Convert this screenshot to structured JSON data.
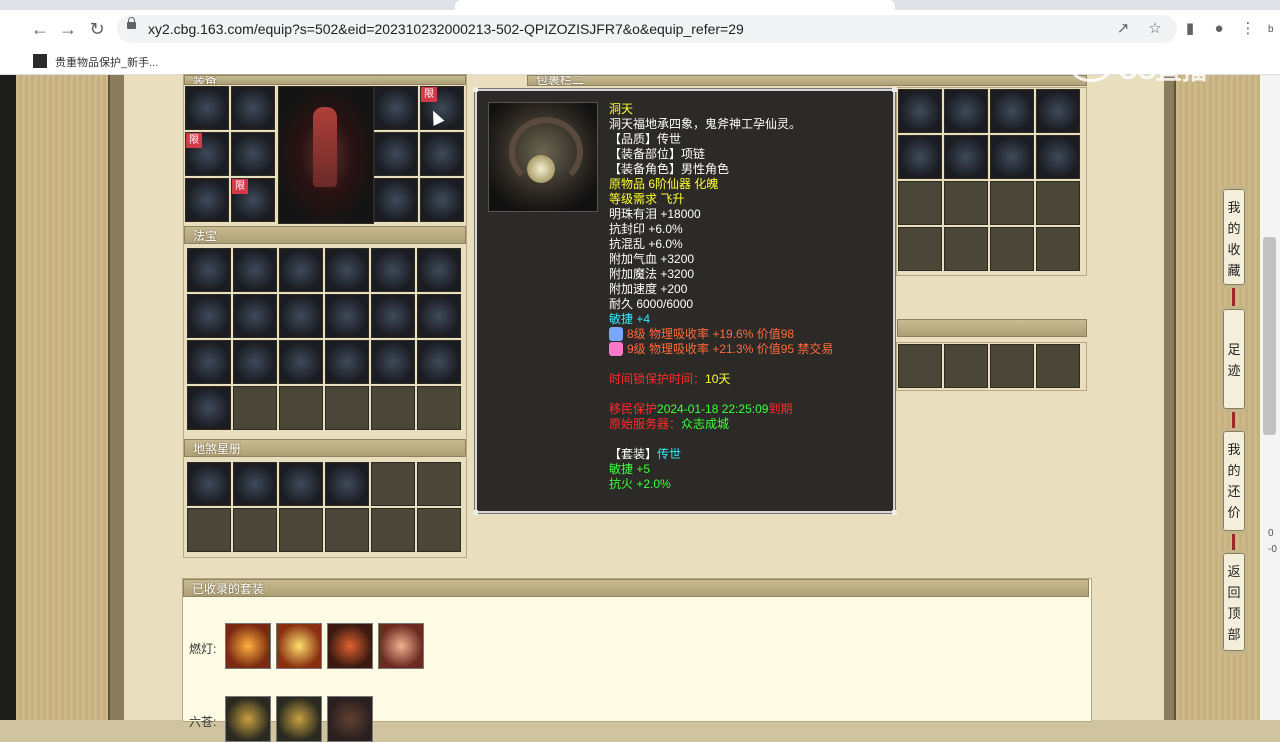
{
  "browser": {
    "url": "xy2.cbg.163.com/equip?s=502&eid=202310232000213-502-QPIZOZISJFR7&o&equip_refer=29",
    "bookmark_label": "贵重物品保护_新手..."
  },
  "watermark": "CC直播",
  "panels": {
    "equip_head": "装备",
    "fabao_head": "法宝",
    "dishu_head": "地煞星册",
    "right_head": "包裹栏二",
    "sets_head": "已收录的套装"
  },
  "equip": {
    "xian_badge": "限"
  },
  "tooltip": {
    "name": "洞天",
    "desc": "洞天福地承四象，鬼斧神工孕仙灵。",
    "lines": [
      {
        "text": "【品质】传世",
        "color": "white"
      },
      {
        "text": "【装备部位】项链",
        "color": "white"
      },
      {
        "text": "【装备角色】男性角色",
        "color": "white"
      },
      {
        "text": "原物品 6阶仙器 化魄",
        "color": "yellow"
      },
      {
        "text": "等级需求 飞升",
        "color": "yellow"
      },
      {
        "text": "明珠有泪 +18000",
        "color": "white"
      },
      {
        "text": "抗封印 +6.0%",
        "color": "white"
      },
      {
        "text": "抗混乱 +6.0%",
        "color": "white"
      },
      {
        "text": "附加气血 +3200",
        "color": "white"
      },
      {
        "text": "附加魔法 +3200",
        "color": "white"
      },
      {
        "text": "附加速度 +200",
        "color": "white"
      },
      {
        "text": "耐久 6000/6000",
        "color": "white"
      },
      {
        "text": "敏捷 +4",
        "color": "cyan"
      }
    ],
    "gems": [
      {
        "text": "8级 物理吸收率 +19.6% 价值98",
        "gem_color": "#7aa6ff"
      },
      {
        "text": "9级 物理吸收率 +21.3% 价值95 禁交易",
        "gem_color": "#ff77c8"
      }
    ],
    "protect_label": "时间锁保护时间：",
    "protect_value": "10天",
    "time_prefix": "移民保护",
    "time_value": "2024-01-18 22:25:09",
    "time_suffix": "到期",
    "server_label": "原始服务器：",
    "server_value": "众志成城",
    "set_label": "【套装】",
    "set_value": "传世",
    "set_bonus1": "敏捷 +5",
    "set_bonus2": "抗火 +2.0%"
  },
  "side_buttons": {
    "favorites": "我的收藏",
    "history": "足迹",
    "counter": "我的还价",
    "top": "返回顶部"
  },
  "sets": {
    "row1_label": "燃灯:",
    "row2_label": "六苍:"
  },
  "scrollbar_text": {
    "a": "b",
    "b": "0",
    "c": "-0"
  }
}
